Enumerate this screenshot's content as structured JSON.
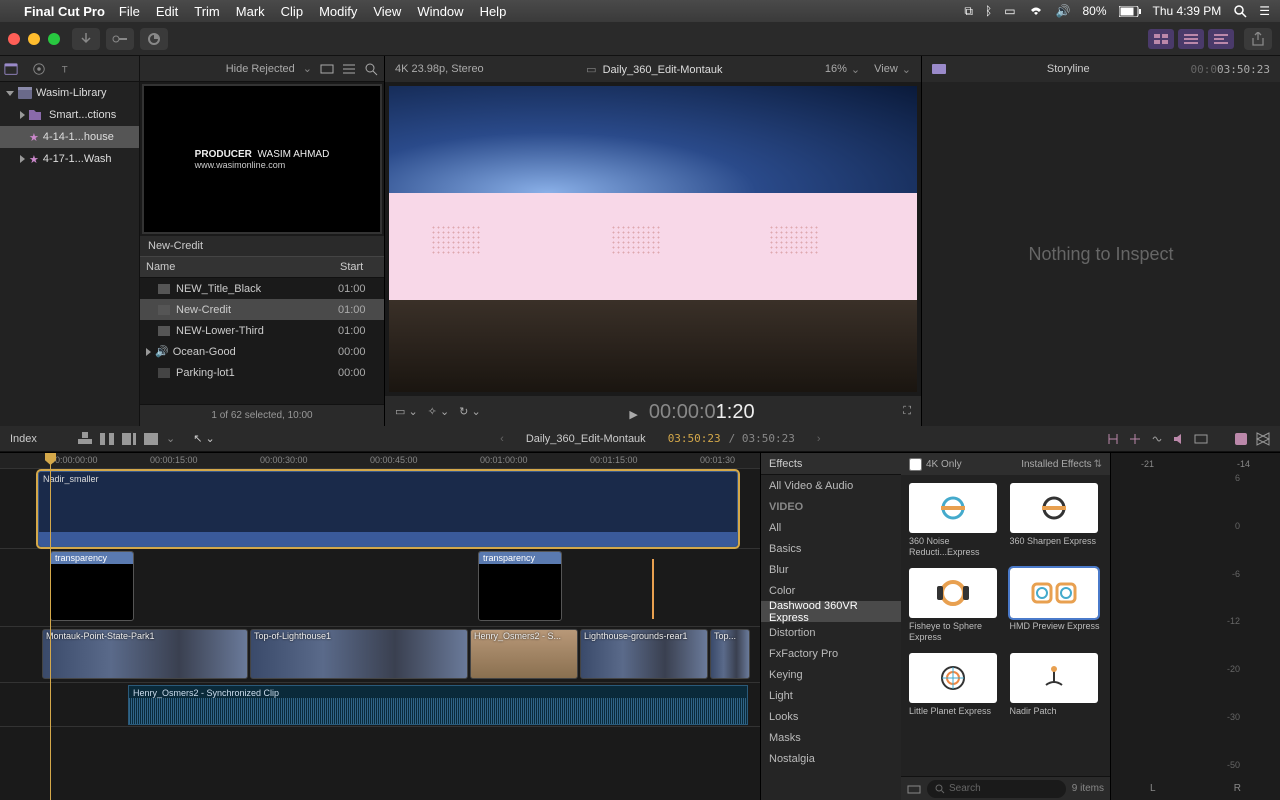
{
  "menubar": {
    "app": "Final Cut Pro",
    "items": [
      "File",
      "Edit",
      "Trim",
      "Mark",
      "Clip",
      "Modify",
      "View",
      "Window",
      "Help"
    ],
    "battery": "80%",
    "clock": "Thu 4:39 PM"
  },
  "library": {
    "root": "Wasim-Library",
    "items": [
      {
        "label": "Smart...ctions",
        "sel": false
      },
      {
        "label": "4-14-1...house",
        "sel": true
      },
      {
        "label": "4-17-1...Wash",
        "sel": false
      }
    ]
  },
  "browser": {
    "hide_rejected": "Hide Rejected",
    "thumb_producer": "PRODUCER",
    "thumb_name": "WASIM AHMAD",
    "thumb_url": "www.wasimonline.com",
    "thumb_label": "New-Credit",
    "col_name": "Name",
    "col_start": "Start",
    "clips": [
      {
        "name": "NEW_Title_Black",
        "start": "01:00"
      },
      {
        "name": "New-Credit",
        "start": "01:00",
        "sel": true
      },
      {
        "name": "NEW-Lower-Third",
        "start": "01:00"
      },
      {
        "name": "Ocean-Good",
        "start": "00:00",
        "audio": true
      },
      {
        "name": "Parking-lot1",
        "start": "00:00"
      }
    ],
    "status": "1 of 62 selected, 10:00"
  },
  "viewer": {
    "format": "4K 23.98p, Stereo",
    "title": "Daily_360_Edit-Montauk",
    "zoom": "16%",
    "view": "View",
    "tc_prefix": "00:00:0",
    "tc_hl": "1:20"
  },
  "inspector": {
    "title": "Storyline",
    "tc": "03:50:23",
    "empty": "Nothing to Inspect"
  },
  "timeline": {
    "index": "Index",
    "title": "Daily_360_Edit-Montauk",
    "tc": "03:50:23",
    "total": "/ 03:50:23",
    "ruler": [
      "00:00:00:00",
      "00:00:15:00",
      "00:00:30:00",
      "00:00:45:00",
      "00:01:00:00",
      "00:01:15:00",
      "00:01:30"
    ],
    "title_clip": "Nadir_smaller",
    "trans_label": "transparency",
    "videos": [
      "Montauk-Point-State-Park1",
      "Top-of-Lighthouse1",
      "Henry_Osmers2 - S...",
      "Lighthouse-grounds-rear1",
      "Top..."
    ],
    "audio": "Henry_Osmers2 - Synchronized Clip"
  },
  "effects": {
    "header": "Effects",
    "fourk": "4K Only",
    "installed": "Installed Effects",
    "top": "All Video & Audio",
    "video_hdr": "VIDEO",
    "cats": [
      "All",
      "Basics",
      "Blur",
      "Color",
      "Dashwood 360VR Express",
      "Distortion",
      "FxFactory Pro",
      "Keying",
      "Light",
      "Looks",
      "Masks",
      "Nostalgia"
    ],
    "sel_cat": 4,
    "items": [
      "360 Noise Reducti...Express",
      "360 Sharpen Express",
      "Fisheye to Sphere Express",
      "HMD Preview Express",
      "Little Planet Express",
      "Nadir Patch"
    ],
    "sel_item": 3,
    "search_ph": "Search",
    "count": "9 items"
  },
  "meters": {
    "peak_l": "-21",
    "peak_r": "-14",
    "scale": [
      "6",
      "0",
      "-6",
      "-12",
      "-20",
      "-30",
      "-50"
    ],
    "l": "L",
    "r": "R"
  }
}
